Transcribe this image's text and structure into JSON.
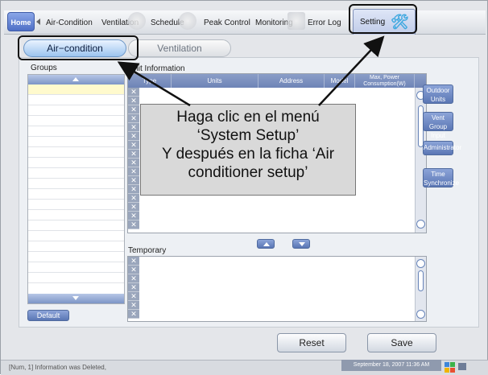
{
  "nav": {
    "home": "Home",
    "items": [
      "Air-Condition",
      "Ventilation",
      "Schedule",
      "Peak Control",
      "Monitoring",
      "Error Log",
      "Setting"
    ]
  },
  "subtabs": [
    "Air−condition",
    "Ventilation"
  ],
  "groups": {
    "title": "Groups",
    "default_button": "Default"
  },
  "unit_info": {
    "title": "Unit Information",
    "columns": [
      "Type",
      "Units",
      "Address",
      "Model",
      "Max, Power Consumption(W)"
    ]
  },
  "temporary": {
    "title": "Temporary"
  },
  "side_buttons": [
    "Outdoor Units",
    "Vent Group Input",
    "Administrator",
    "Time Synchronize"
  ],
  "actions": {
    "reset": "Reset",
    "save": "Save"
  },
  "status": {
    "message": "[Num, 1] Information was Deleted,",
    "datetime": "September 18, 2007 11:36 AM"
  },
  "callout": {
    "line1": "Haga clic en el menú",
    "line2": "‘System Setup’",
    "line3": "Y después en la ficha ‘Air",
    "line4": "conditioner setup’"
  },
  "colors": {
    "accent": "#5a76b4",
    "highlight_row": "#fffacd"
  },
  "icons": [
    "home-icon",
    "wrench-icon",
    "table-delete-icon",
    "scroll-up-icon",
    "scroll-down-icon"
  ]
}
